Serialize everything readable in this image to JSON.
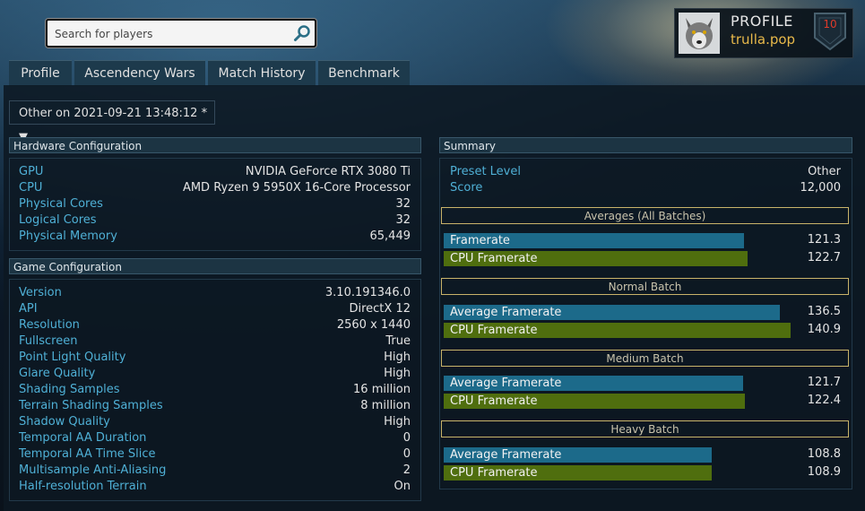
{
  "search": {
    "placeholder": "Search for players"
  },
  "profile": {
    "title": "PROFILE",
    "username": "trulla.pop",
    "level": "10"
  },
  "tabs": [
    "Profile",
    "Ascendency Wars",
    "Match History",
    "Benchmark"
  ],
  "run_selector": {
    "value": "Other on 2021-09-21 13:48:12 * ▼"
  },
  "hardware": {
    "header": "Hardware Configuration",
    "rows": [
      {
        "label": "GPU",
        "value": "NVIDIA GeForce RTX 3080 Ti"
      },
      {
        "label": "CPU",
        "value": "AMD Ryzen 9 5950X 16-Core Processor"
      },
      {
        "label": "Physical Cores",
        "value": "32"
      },
      {
        "label": "Logical Cores",
        "value": "32"
      },
      {
        "label": "Physical Memory",
        "value": "65,449"
      }
    ]
  },
  "game": {
    "header": "Game Configuration",
    "rows": [
      {
        "label": "Version",
        "value": "3.10.191346.0"
      },
      {
        "label": "API",
        "value": "DirectX 12"
      },
      {
        "label": "Resolution",
        "value": "2560 x 1440"
      },
      {
        "label": "Fullscreen",
        "value": "True"
      },
      {
        "label": "Point Light Quality",
        "value": "High"
      },
      {
        "label": "Glare Quality",
        "value": "High"
      },
      {
        "label": "Shading Samples",
        "value": "16 million"
      },
      {
        "label": "Terrain Shading Samples",
        "value": "8 million"
      },
      {
        "label": "Shadow Quality",
        "value": "High"
      },
      {
        "label": "Temporal AA Duration",
        "value": "0"
      },
      {
        "label": "Temporal AA Time Slice",
        "value": "0"
      },
      {
        "label": "Multisample Anti-Aliasing",
        "value": "2"
      },
      {
        "label": "Half-resolution Terrain",
        "value": "On"
      }
    ]
  },
  "summary": {
    "header": "Summary",
    "rows": [
      {
        "label": "Preset Level",
        "value": "Other"
      },
      {
        "label": "Score",
        "value": "12,000"
      }
    ],
    "batches": [
      {
        "title": "Averages (All Batches)",
        "bars": [
          {
            "label": "Framerate",
            "value": "121.3",
            "color": "#1c6a8a",
            "fill": 0.865
          },
          {
            "label": "CPU Framerate",
            "value": "122.7",
            "color": "#4f6e0e",
            "fill": 0.875
          }
        ]
      },
      {
        "title": "Normal Batch",
        "bars": [
          {
            "label": "Average Framerate",
            "value": "136.5",
            "color": "#1c6a8a",
            "fill": 0.969
          },
          {
            "label": "CPU Framerate",
            "value": "140.9",
            "color": "#4f6e0e",
            "fill": 1.0
          }
        ]
      },
      {
        "title": "Medium Batch",
        "bars": [
          {
            "label": "Average Framerate",
            "value": "121.7",
            "color": "#1c6a8a",
            "fill": 0.864
          },
          {
            "label": "CPU Framerate",
            "value": "122.4",
            "color": "#4f6e0e",
            "fill": 0.869
          }
        ]
      },
      {
        "title": "Heavy Batch",
        "bars": [
          {
            "label": "Average Framerate",
            "value": "108.8",
            "color": "#1c6a8a",
            "fill": 0.772
          },
          {
            "label": "CPU Framerate",
            "value": "108.9",
            "color": "#4f6e0e",
            "fill": 0.773
          }
        ]
      }
    ]
  },
  "icons": {
    "search": "search-icon",
    "avatar": "wolf-avatar",
    "level": "level-shield-icon",
    "dropdown": "chevron-down-icon"
  },
  "colors": {
    "label": "#4fb0d6",
    "profile_name": "#e8b94a",
    "level": "#e03a2a",
    "bar_blue": "#1c6a8a",
    "bar_green": "#4f6e0e",
    "batch_border": "#c9b36a"
  }
}
